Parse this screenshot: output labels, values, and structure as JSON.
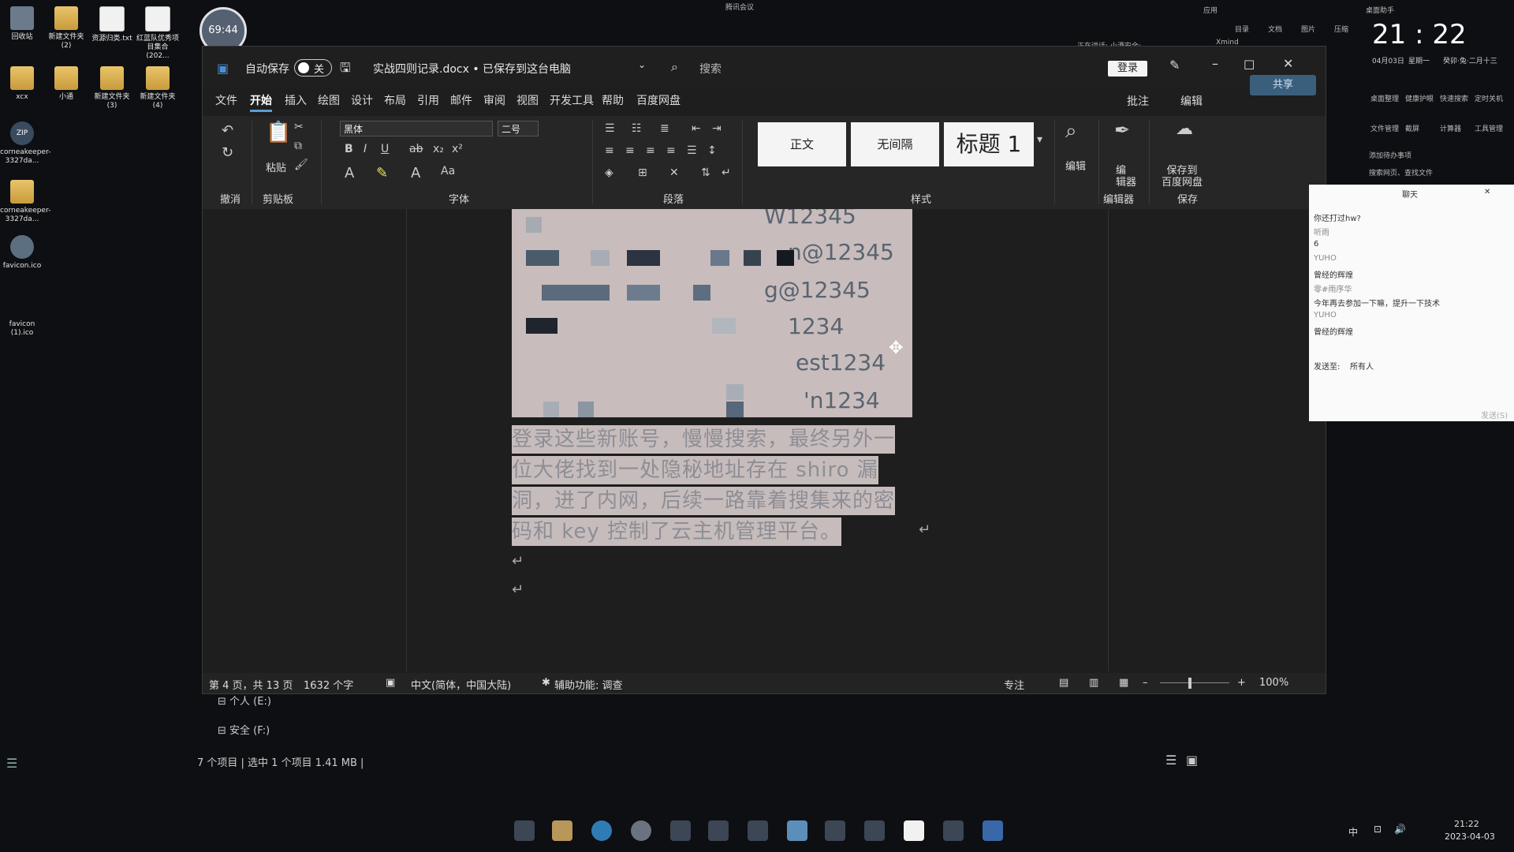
{
  "desktop": {
    "icons": [
      {
        "label": "回收站",
        "icon": "recycle-bin-icon"
      },
      {
        "label": "新建文件夹\n(2)",
        "icon": "folder-icon"
      },
      {
        "label": "资源归类.txt",
        "icon": "text-file-icon"
      },
      {
        "label": "红蓝队优秀项目集合(202...",
        "icon": "document-icon"
      },
      {
        "label": "xcx",
        "icon": "folder-icon"
      },
      {
        "label": "小通",
        "icon": "folder-icon"
      },
      {
        "label": "新建文件夹\n(3)",
        "icon": "folder-icon"
      },
      {
        "label": "新建文件夹\n(4)",
        "icon": "folder-icon"
      },
      {
        "label": "corneakeeper-3327da...",
        "icon": "zip-icon",
        "badge": "ZIP"
      },
      {
        "label": "corneakeeper-3327da...",
        "icon": "folder-icon"
      },
      {
        "label": "favicon.ico",
        "icon": "favicon-icon"
      },
      {
        "label": "favicon\n(1).ico",
        "icon": "favicon-icon"
      }
    ]
  },
  "timer": "69:44",
  "top_notice": {
    "meeting": "腾讯会议",
    "speaking": "正在讲话: 小酒安全;",
    "xmind": "Xmind"
  },
  "word": {
    "autosave_label": "自动保存",
    "autosave_state": "关",
    "doc_title": "实战四则记录.docx • 已保存到这台电脑",
    "search_placeholder": "搜索",
    "login": "登录",
    "menu": [
      "文件",
      "开始",
      "插入",
      "绘图",
      "设计",
      "布局",
      "引用",
      "邮件",
      "审阅",
      "视图",
      "开发工具",
      "帮助",
      "百度网盘"
    ],
    "active_menu": "开始",
    "comment_btn": "批注",
    "edit_btn": "编辑",
    "share_btn": "共享",
    "ribbon": {
      "undo_group": "撤消",
      "paste": "粘贴",
      "clipboard_group": "剪贴板",
      "font_name": "黑体",
      "font_size": "二号",
      "font_group": "字体",
      "paragraph_group": "段落",
      "styles": [
        "正文",
        "无间隔",
        "标题 1"
      ],
      "styles_group": "样式",
      "find_label": "编辑",
      "editor_label": "编\n辑器",
      "editor_group": "编辑器",
      "save_baidu": "保存到\n百度网盘",
      "save_group": "保存"
    },
    "screenshot_lines": [
      "W12345",
      "n@12345",
      "g@12345",
      "1234",
      "est1234",
      "'n1234"
    ],
    "paragraph_lines": [
      "登录这些新账号，慢慢搜索，最终另外一",
      "位大佬找到一处隐秘地址存在 shiro 漏",
      "洞，进了内网，后续一路靠着搜集来的密",
      "码和 key 控制了云主机管理平台。"
    ],
    "status": {
      "page": "第 4 页，共 13 页",
      "words": "1632 个字",
      "language": "中文(简体，中国大陆)",
      "accessibility": "辅助功能: 调查",
      "focus": "专注",
      "zoom": "100%"
    }
  },
  "explorer": {
    "drive_e": "个人 (E:)",
    "drive_f": "安全 (F:)",
    "status": "7 个项目  |  选中 1 个项目  1.41 MB  |"
  },
  "chat": {
    "title": "聊天",
    "messages": [
      "你还打过hw?",
      "听雨",
      "6",
      "YUHO",
      "曾经的辉煌",
      "零#雨序华",
      "今年再去参加一下嘛，提升一下技术",
      "YUHO",
      "曾经的辉煌"
    ],
    "send_to_label": "发送至:",
    "send_to_value": "所有人",
    "send": "发送(S)"
  },
  "widget": {
    "app_label": "应用",
    "assistant": "桌面助手",
    "time": "21 : 22",
    "date": "04月03日",
    "weekday": "星期一",
    "lunar": "癸卯·兔·二月十三",
    "shortcuts": [
      "目录",
      "文档",
      "图片",
      "压缩"
    ],
    "tools": [
      "桌面整理",
      "健康护眼",
      "快速搜索",
      "定时关机",
      "文件管理",
      "截屏",
      "计算器",
      "工具管理"
    ],
    "todo": "添加待办事项",
    "search": "搜索网页、查找文件"
  },
  "taskbar": {
    "ime": "中",
    "time": "21:22",
    "date": "2023-04-03"
  }
}
